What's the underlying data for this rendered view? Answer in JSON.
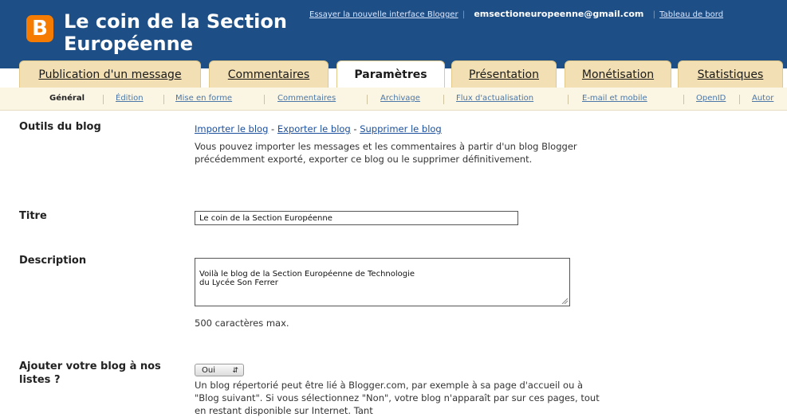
{
  "header": {
    "logo_letter": "B",
    "blog_title": "Le coin de la Section Européenne",
    "try_new_link": "Essayer la nouvelle interface Blogger",
    "email": "emsectioneuropeenne@gmail.com",
    "dashboard_link": "Tableau de bord"
  },
  "tabs": [
    "Publication d'un message",
    "Commentaires",
    "Paramètres",
    "Présentation",
    "Monétisation",
    "Statistiques"
  ],
  "subnav": [
    "Général",
    "Édition",
    "Mise en forme",
    "Commentaires",
    "Archivage",
    "Flux d'actualisation",
    "E-mail et mobile",
    "OpenID",
    "Autor"
  ],
  "sections": {
    "tools": {
      "label": "Outils du blog",
      "import": "Importer le blog",
      "export": "Exporter le blog",
      "delete": "Supprimer le blog",
      "dash": " - ",
      "help": "Vous pouvez importer les messages et les commentaires à partir d'un blog Blogger précédemment exporté, exporter ce blog ou le supprimer définitivement."
    },
    "title": {
      "label": "Titre",
      "value": "Le coin de la Section Européenne"
    },
    "description": {
      "label": "Description",
      "value": "Voilà le blog de la Section Européenne de Technologie\ndu Lycée Son Ferrer",
      "max": "500 caractères max."
    },
    "listing": {
      "label": "Ajouter votre blog à nos listes ?",
      "select_value": "Oui",
      "help": "Un blog répertorié peut être lié à Blogger.com, par exemple à sa page d'accueil ou à \"Blog suivant\". Si vous sélectionnez \"Non\", votre blog n'apparaît par sur ces pages, tout en restant disponible sur Internet. Tant"
    }
  }
}
